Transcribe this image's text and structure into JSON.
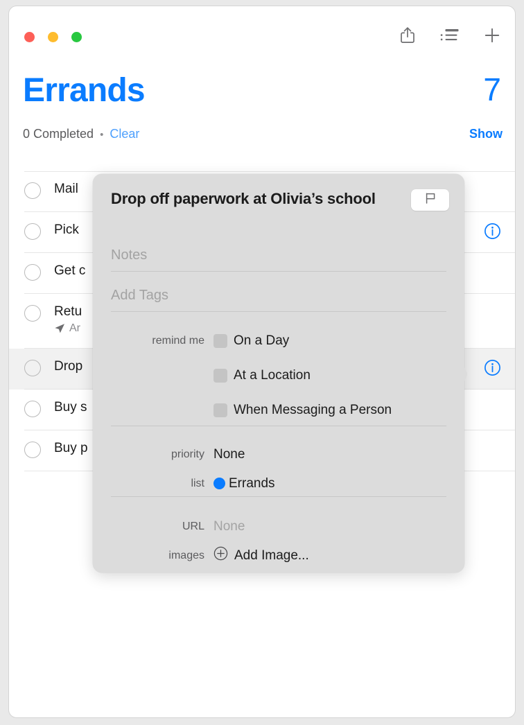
{
  "window": {
    "traffic_lights": [
      {
        "name": "close",
        "color": "#fd5f57"
      },
      {
        "name": "minimize",
        "color": "#febc2e"
      },
      {
        "name": "zoom",
        "color": "#28c840"
      }
    ]
  },
  "toolbar": {
    "share_icon": "share-icon",
    "view_options_icon": "list-view-icon",
    "add_icon": "plus-icon"
  },
  "header": {
    "title": "Errands",
    "count": "7",
    "completed_text": "0 Completed",
    "separator": "•",
    "clear_label": "Clear",
    "show_label": "Show",
    "accent_color": "#0a7cff"
  },
  "reminders": [
    {
      "title": "Mail",
      "subtitle": "",
      "selected": false,
      "has_info": false
    },
    {
      "title": "Pick",
      "subtitle": "",
      "selected": false,
      "has_info": true
    },
    {
      "title": "Get c",
      "subtitle": "",
      "selected": false,
      "has_info": false
    },
    {
      "title": "Retu",
      "subtitle": "Ar",
      "selected": false,
      "has_info": false
    },
    {
      "title": "Drop",
      "subtitle": "",
      "selected": true,
      "has_info": true
    },
    {
      "title": "Buy s",
      "subtitle": "",
      "selected": false,
      "has_info": false
    },
    {
      "title": "Buy p",
      "subtitle": "",
      "selected": false,
      "has_info": false
    }
  ],
  "popover": {
    "task_title": "Drop off paperwork at Olivia’s school",
    "flag_icon": "flag-icon",
    "notes_placeholder": "Notes",
    "tags_placeholder": "Add Tags",
    "remind_me_label": "remind me",
    "remind_options": [
      {
        "label": "On a Day",
        "checked": false
      },
      {
        "label": "At a Location",
        "checked": false
      },
      {
        "label": "When Messaging a Person",
        "checked": false
      }
    ],
    "priority_label": "priority",
    "priority_value": "None",
    "list_label": "list",
    "list_value": "Errands",
    "list_color": "#0a7cff",
    "url_label": "URL",
    "url_value": "None",
    "images_label": "images",
    "add_image_label": "Add Image...",
    "add_image_icon": "plus-circle-icon"
  }
}
